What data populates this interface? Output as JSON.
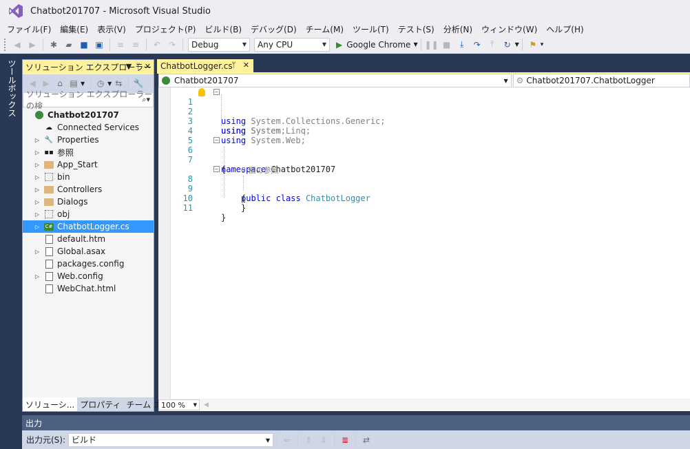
{
  "window": {
    "title": "Chatbot201707 - Microsoft Visual Studio"
  },
  "menu": [
    "ファイル(F)",
    "編集(E)",
    "表示(V)",
    "プロジェクト(P)",
    "ビルド(B)",
    "デバッグ(D)",
    "チーム(M)",
    "ツール(T)",
    "テスト(S)",
    "分析(N)",
    "ウィンドウ(W)",
    "ヘルプ(H)"
  ],
  "toolbar": {
    "config": "Debug",
    "platform": "Any CPU",
    "run_target": "Google Chrome"
  },
  "toolbox": {
    "label": "ツールボックス"
  },
  "solution_explorer": {
    "title": "ソリューション エクスプローラー",
    "search_placeholder": "ソリューション エクスプローラー の検",
    "project": "Chatbot201707",
    "items": [
      {
        "label": "Connected Services",
        "icon": "cloud-icon",
        "expandable": false
      },
      {
        "label": "Properties",
        "icon": "wrench-icon",
        "expandable": true
      },
      {
        "label": "参照",
        "icon": "reference-icon",
        "expandable": true
      },
      {
        "label": "App_Start",
        "icon": "folder-icon",
        "expandable": true
      },
      {
        "label": "bin",
        "icon": "dotted-folder-icon",
        "expandable": true
      },
      {
        "label": "Controllers",
        "icon": "folder-icon",
        "expandable": true
      },
      {
        "label": "Dialogs",
        "icon": "folder-icon",
        "expandable": true
      },
      {
        "label": "obj",
        "icon": "dotted-folder-icon",
        "expandable": true
      },
      {
        "label": "ChatbotLogger.cs",
        "icon": "csharp-file-icon",
        "expandable": true,
        "selected": true
      },
      {
        "label": "default.htm",
        "icon": "html-file-icon",
        "expandable": false
      },
      {
        "label": "Global.asax",
        "icon": "globe-file-icon",
        "expandable": true
      },
      {
        "label": "packages.config",
        "icon": "config-file-icon",
        "expandable": false
      },
      {
        "label": "Web.config",
        "icon": "config-file-icon",
        "expandable": true
      },
      {
        "label": "WebChat.html",
        "icon": "html-file-icon",
        "expandable": false
      }
    ],
    "bottom_tabs": [
      "ソリューシ...",
      "プロパティ",
      "チーム エク..."
    ]
  },
  "editor": {
    "tab_label": "ChatbotLogger.cs",
    "nav_left": "Chatbot201707",
    "nav_right": "Chatbot201707.ChatbotLogger",
    "zoom": "100 %",
    "code_lens": "0 個の参照",
    "lines": {
      "l1_kw": "using",
      "l1_rest": " System;",
      "l2_kw": "using",
      "l2_rest": " System.Collections.Generic;",
      "l3_kw": "using",
      "l3_rest": " System.Linq;",
      "l4_kw": "using",
      "l4_rest": " System.Web;",
      "l6_kw": "namespace",
      "l6_rest": " Chatbot201707",
      "l7": "{",
      "l8_kw": "public class",
      "l8_type": "ChatbotLogger",
      "l9": "{",
      "l10": "}",
      "l11": "}"
    },
    "line_numbers": [
      "1",
      "2",
      "3",
      "4",
      "5",
      "6",
      "7",
      "8",
      "9",
      "10",
      "11"
    ]
  },
  "output": {
    "title": "出力",
    "source_label": "出力元(S):",
    "source_value": "ビルド"
  },
  "colors": {
    "accent_tab": "#fff29d",
    "selection": "#3399ff",
    "frame": "#293955"
  }
}
